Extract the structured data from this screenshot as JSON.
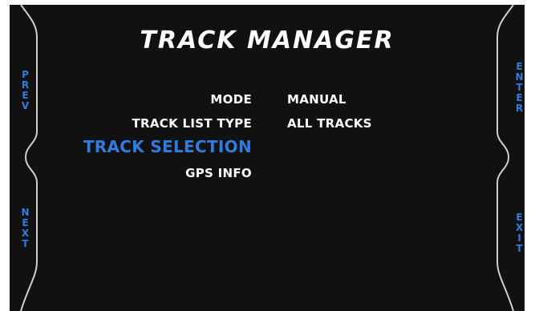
{
  "screen": {
    "title": "TRACK MANAGER"
  },
  "side_buttons": {
    "prev": "PREV",
    "next": "NEXT",
    "enter": "ENTER",
    "exit": "EXIT"
  },
  "menu": {
    "items": [
      {
        "label": "MODE",
        "value": "MANUAL",
        "selected": false
      },
      {
        "label": "TRACK LIST TYPE",
        "value": "ALL TRACKS",
        "selected": false
      },
      {
        "label": "TRACK SELECTION",
        "value": "",
        "selected": true
      },
      {
        "label": "GPS INFO",
        "value": "",
        "selected": false
      }
    ]
  },
  "colors": {
    "background": "#111111",
    "text": "#ffffff",
    "accent": "#2f7de0",
    "frame_line": "#cfcfcf"
  }
}
